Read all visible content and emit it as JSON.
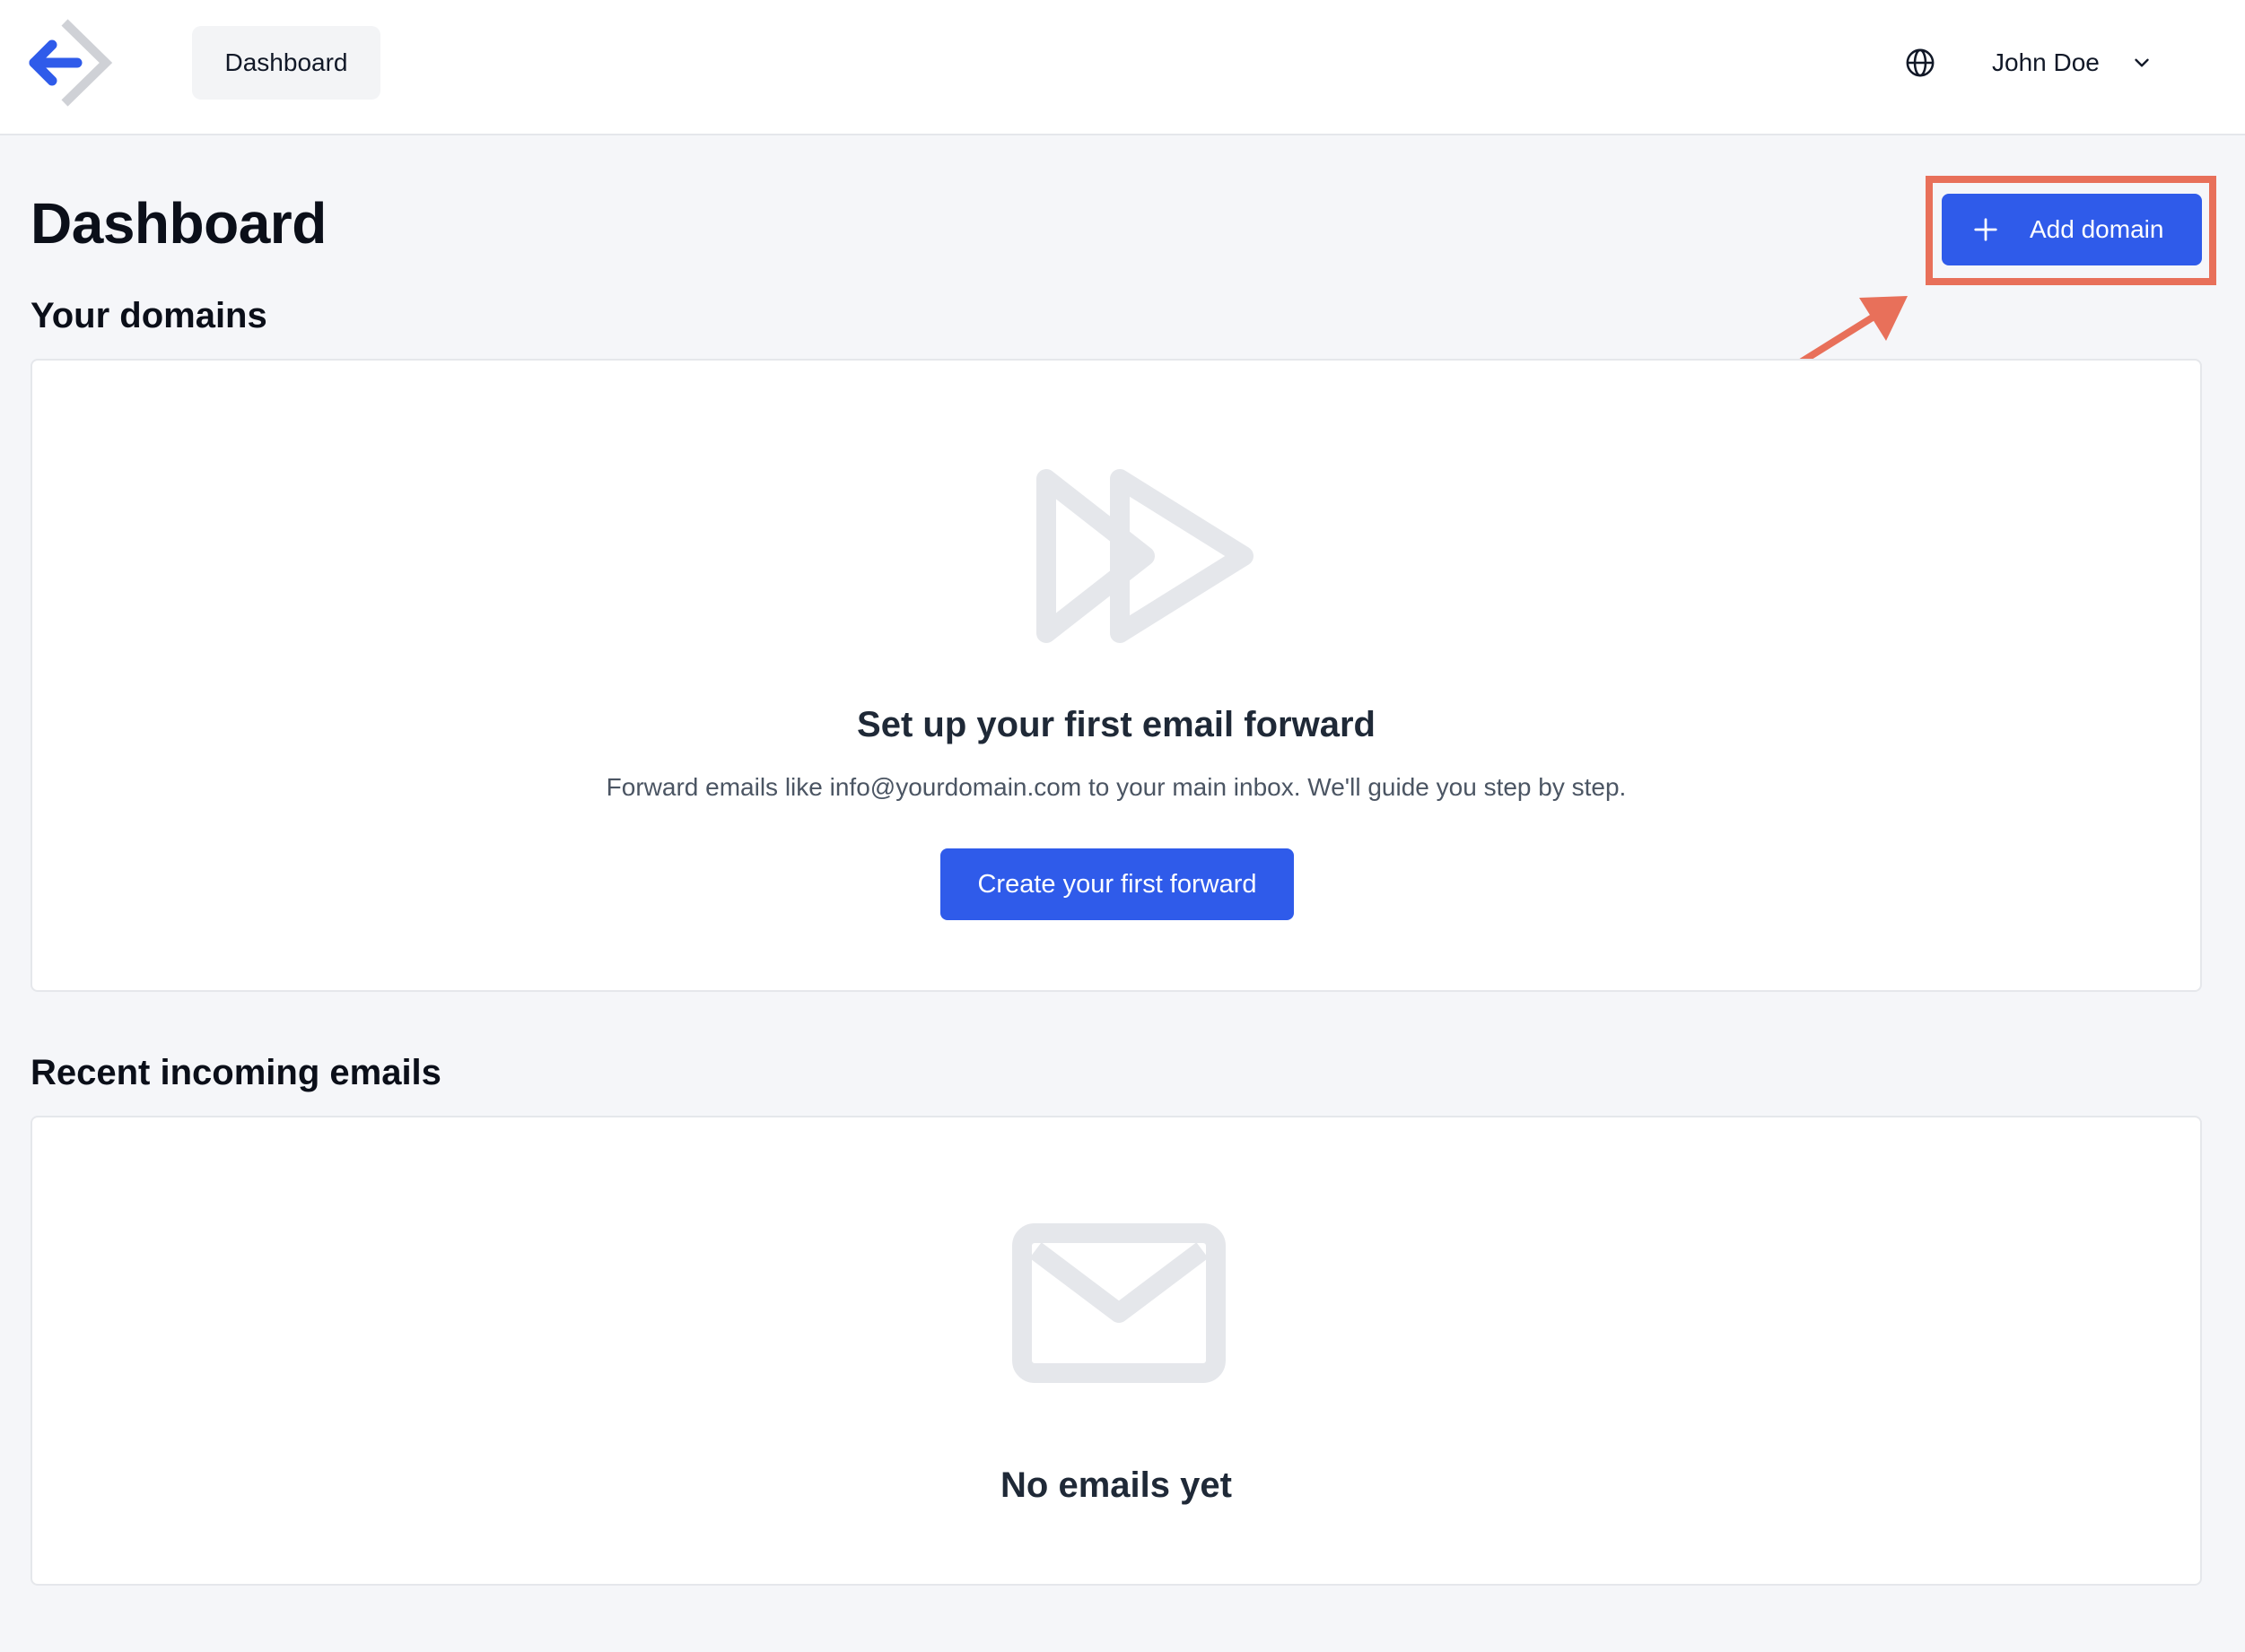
{
  "header": {
    "nav_tab_label": "Dashboard",
    "user_name": "John Doe",
    "icons": {
      "logo": "forward-arrow-logo",
      "globe": "globe-icon",
      "chevron": "chevron-down-icon"
    }
  },
  "page": {
    "title": "Dashboard",
    "add_domain_label": "Add domain"
  },
  "domains": {
    "section_title": "Your domains",
    "empty_title": "Set up your first email forward",
    "empty_description": "Forward emails like info@yourdomain.com to your main inbox. We'll guide you step by step.",
    "cta_label": "Create your first forward"
  },
  "emails": {
    "section_title": "Recent incoming emails",
    "empty_title": "No emails yet"
  },
  "colors": {
    "primary": "#2f5bea",
    "annotation": "#e8705a",
    "background": "#f5f6f9",
    "empty_icon": "#e5e7eb"
  }
}
